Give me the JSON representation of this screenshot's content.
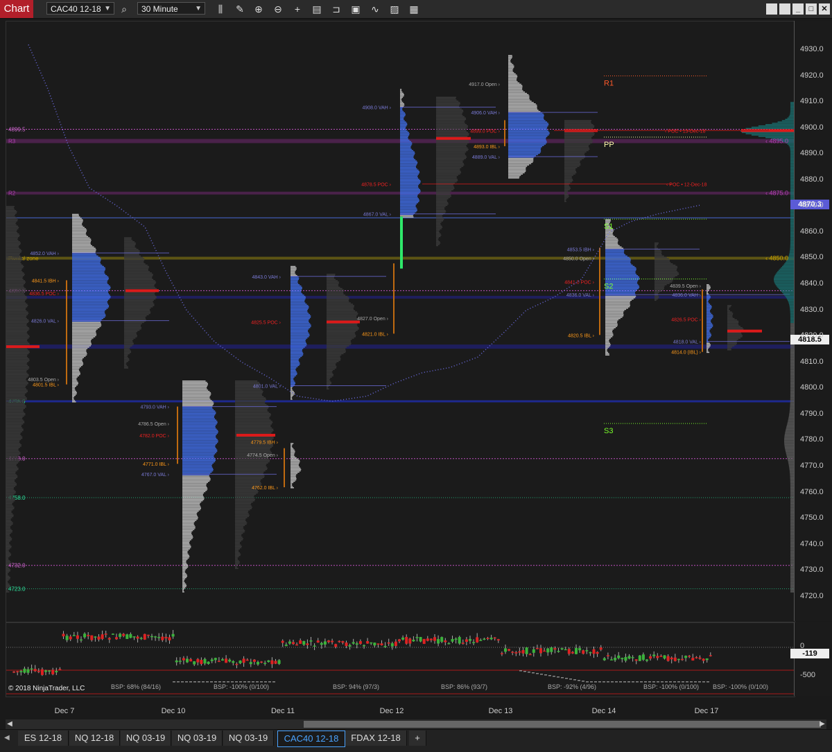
{
  "toolbar": {
    "chart_label": "Chart",
    "instrument": "CAC40 12-18",
    "interval": "30 Minute",
    "icons": [
      "search-icon",
      "bar-type-icon",
      "draw-icon",
      "zoom-in-icon",
      "zoom-out-icon",
      "crosshair-icon",
      "properties-icon",
      "data-box-icon",
      "strategy-icon",
      "indicator-icon",
      "templates-icon",
      "grid-icon"
    ],
    "window_buttons": [
      "restore-icon",
      "maximize-icon",
      "minimize-icon",
      "close-icon"
    ]
  },
  "price_axis": {
    "ticks": [
      "4930.0",
      "4920.0",
      "4910.0",
      "4900.0",
      "4890.0",
      "4880.0",
      "4870.0",
      "4860.0",
      "4850.0",
      "4840.0",
      "4830.0",
      "4820.0",
      "4810.0",
      "4800.0",
      "4790.0",
      "4780.0",
      "4770.0",
      "4760.0",
      "4750.0",
      "4740.0",
      "4730.0",
      "4720.0"
    ],
    "last_price_blue": "4870.3",
    "last_price_white": "4818.5"
  },
  "left_levels": [
    {
      "text": "4899.5",
      "color": "#d36ad3"
    },
    {
      "text": "R3",
      "color": "#b040b0"
    },
    {
      "text": "R2",
      "color": "#b040b0"
    },
    {
      "text": "Pivotal zone",
      "color": "#c8a000"
    },
    {
      "text": "4837.5",
      "color": "#d36ad3"
    },
    {
      "text": "4795.0",
      "color": "#2ee8a0"
    },
    {
      "text": "4773.0",
      "color": "#d36ad3"
    },
    {
      "text": "4758.0",
      "color": "#2ee8a0"
    },
    {
      "text": "4732.0",
      "color": "#d36ad3"
    },
    {
      "text": "4723.0",
      "color": "#2ee8a0"
    }
  ],
  "pivots": {
    "r1": "R1",
    "pp": "PP",
    "s1": "S1",
    "s2": "S2",
    "s3": "S3"
  },
  "right_levels": [
    "4895.0",
    "4875.0",
    "4850.0"
  ],
  "naked_poc": [
    "POC • 13-Dec-18",
    "POC • 12-Dec-18"
  ],
  "profiles": [
    {
      "labels": [
        {
          "t": "4852.0 VAH",
          "c": "#7a7ad6"
        },
        {
          "t": "4841.5 IBH",
          "c": "#ff9a1a"
        },
        {
          "t": "4836.5 POC",
          "c": "#e22"
        },
        {
          "t": "4826.0 VAL",
          "c": "#7a7ad6"
        },
        {
          "t": "4803.5 Open",
          "c": "#aaa"
        },
        {
          "t": "4801.5 IBL",
          "c": "#ff9a1a"
        }
      ]
    },
    {
      "labels": [
        {
          "t": "4793.0 VAH",
          "c": "#7a7ad6"
        },
        {
          "t": "4786.5 Open",
          "c": "#aaa"
        },
        {
          "t": "4782.0 POC",
          "c": "#e22"
        },
        {
          "t": "4771.0 IBL",
          "c": "#ff9a1a"
        },
        {
          "t": "4767.0 VAL",
          "c": "#7a7ad6"
        }
      ]
    },
    {
      "labels": [
        {
          "t": "4779.5 IBH",
          "c": "#ff9a1a"
        },
        {
          "t": "4774.5 Open",
          "c": "#aaa"
        },
        {
          "t": "4762.0 IBL",
          "c": "#ff9a1a"
        }
      ]
    },
    {
      "labels": [
        {
          "t": "4843.0 VAH",
          "c": "#7a7ad6"
        },
        {
          "t": "4825.5 POC",
          "c": "#e22"
        },
        {
          "t": "4801.0 VAL",
          "c": "#7a7ad6"
        }
      ]
    },
    {
      "labels": [
        {
          "t": "4827.0 Open",
          "c": "#aaa"
        },
        {
          "t": "4821.0 IBL",
          "c": "#ff9a1a"
        }
      ]
    },
    {
      "labels": [
        {
          "t": "4908.0 VAH",
          "c": "#7a7ad6"
        },
        {
          "t": "4878.5 POC",
          "c": "#e22"
        },
        {
          "t": "4867.0 VAL",
          "c": "#7a7ad6"
        }
      ]
    },
    {
      "labels": [
        {
          "t": "4917.0 Open",
          "c": "#aaa"
        },
        {
          "t": "4906.0 VAH",
          "c": "#7a7ad6"
        },
        {
          "t": "4899.0 POC",
          "c": "#e22"
        },
        {
          "t": "4893.0 IBL",
          "c": "#ff9a1a"
        },
        {
          "t": "4889.0 VAL",
          "c": "#7a7ad6"
        }
      ]
    },
    {
      "labels": [
        {
          "t": "4853.5 IBH",
          "c": "#7a7ad6"
        },
        {
          "t": "4850.0 Open",
          "c": "#aaa"
        },
        {
          "t": "4841.0 POC",
          "c": "#e22"
        },
        {
          "t": "4836.0 VAL",
          "c": "#7a7ad6"
        },
        {
          "t": "4820.5 IBL",
          "c": "#ff9a1a"
        }
      ]
    },
    {
      "labels": [
        {
          "t": "4839.5 Open",
          "c": "#aaa"
        },
        {
          "t": "4836.0 VAH",
          "c": "#7a7ad6"
        },
        {
          "t": "4826.5 POC",
          "c": "#e22"
        },
        {
          "t": "4818.0 VAL",
          "c": "#7a7ad6"
        },
        {
          "t": "4814.0 (IBL)",
          "c": "#ff9a1a"
        }
      ]
    }
  ],
  "subpanel": {
    "axis_ticks": [
      "0",
      "-500"
    ],
    "current": "-119",
    "bsp": [
      "BSP: 68% (84/16)",
      "BSP: -100% (0/100)",
      "BSP: 94% (97/3)",
      "BSP: 86% (93/7)",
      "BSP: -92% (4/96)",
      "BSP: -100% (0/100)",
      "BSP: -100% (0/100)"
    ]
  },
  "copyright": "© 2018 NinjaTrader, LLC",
  "time_axis": [
    "Dec 7",
    "Dec 10",
    "Dec 11",
    "Dec 12",
    "Dec 13",
    "Dec 14",
    "Dec 17"
  ],
  "tabs": [
    "ES 12-18",
    "NQ 12-18",
    "NQ 03-19",
    "NQ 03-19",
    "NQ 03-19",
    "CAC40 12-18",
    "FDAX 12-18"
  ],
  "add_tab": "+",
  "colors": {
    "profile_blue": "#3f6be0",
    "profile_grey": "#bbbbbb",
    "poc_red": "#dd1a1a",
    "va_line": "#5a5ab0"
  }
}
